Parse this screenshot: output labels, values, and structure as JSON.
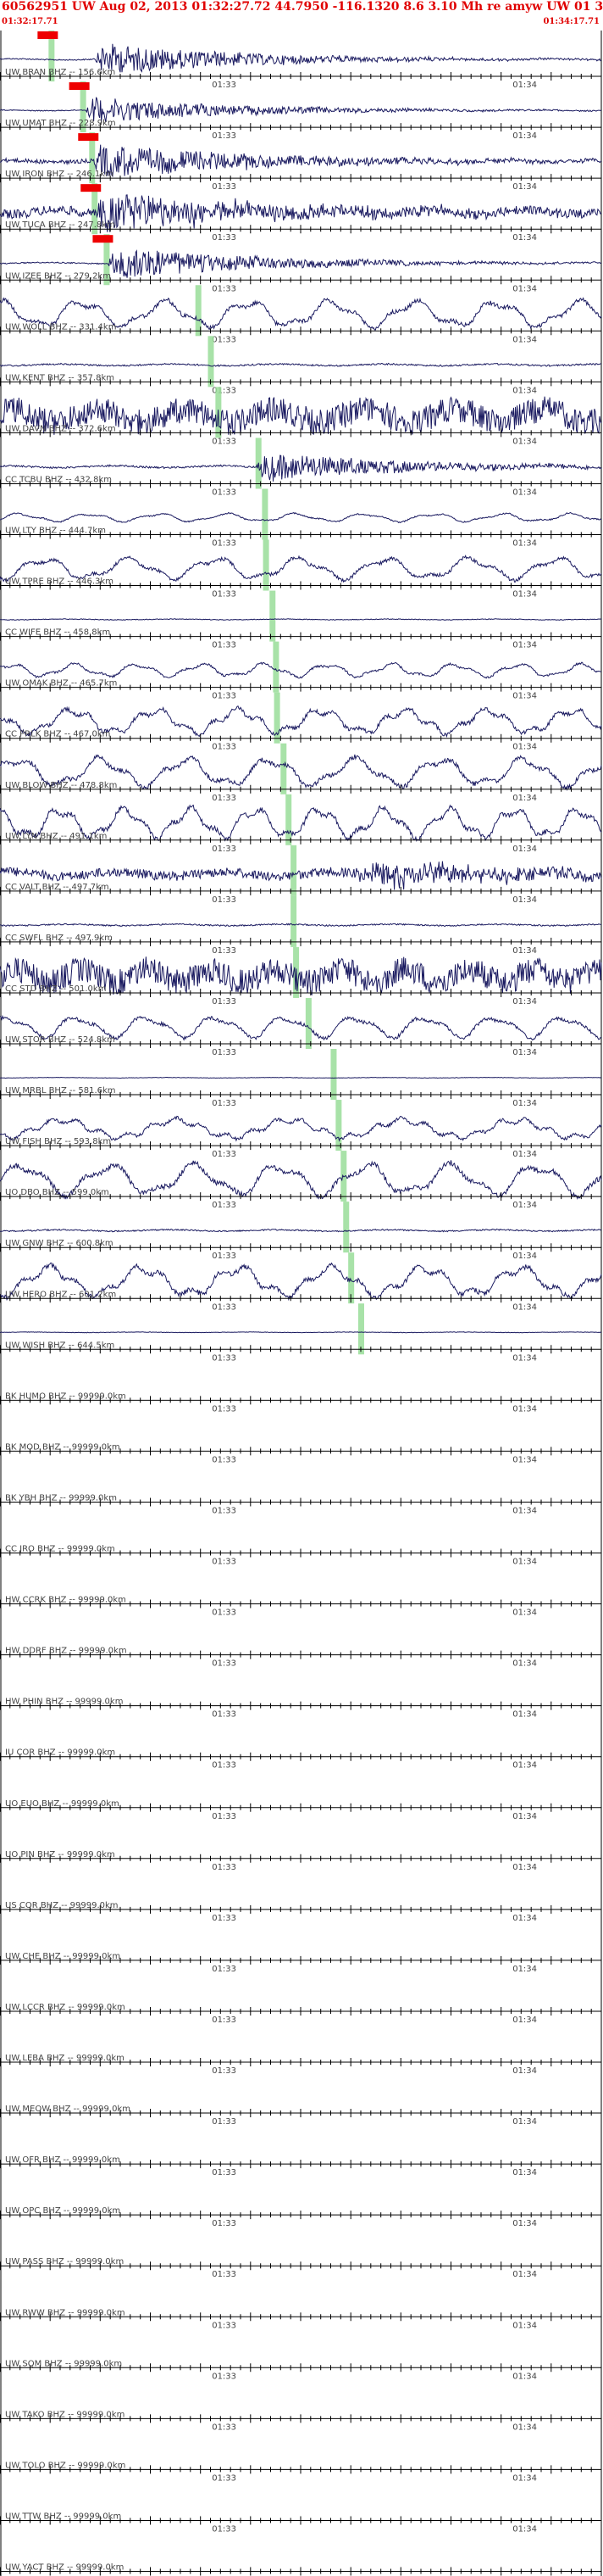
{
  "header": {
    "title": "60562951 UW Aug 02, 2013 01:32:27.72   44.7950  -116.1320  8.6 3.10 Mh re amyw UW 01   3",
    "start_time": "01:32:17.71",
    "end_time": "01:34:17.71"
  },
  "colors": {
    "header_text": "#e00000",
    "trace": "#1a1a60",
    "pick_marker": "#99dd99",
    "pick_flag": "#ee0000",
    "axis": "#000000",
    "label_text": "#444444"
  },
  "chart_data": {
    "type": "line",
    "title": "60562951 UW Aug 02, 2013 01:32:27.72   44.7950  -116.1320  8.6 3.10 Mh re amyw UW 01   3",
    "x_start_time": "01:32:17.71",
    "x_end_time": "01:34:17.71",
    "time_labels": [
      "01:33",
      "01:34"
    ],
    "time_label_seconds": [
      42.29,
      102.29
    ],
    "xlim_seconds": [
      0,
      120
    ],
    "channels": [
      {
        "name": "UW BRAN BHZ -- 156.6km",
        "pick_s": 10.2,
        "has_flag": true,
        "amplitude": 0.25,
        "noise": "low",
        "event_start_s": 19,
        "event_peak": 2.2
      },
      {
        "name": "UW UMAT BHZ -- 228.9km",
        "pick_s": 16.5,
        "has_flag": true,
        "amplitude": 0.2,
        "noise": "low",
        "event_start_s": 17,
        "event_peak": 1.8
      },
      {
        "name": "UW IRON BHZ -- 246.1km",
        "pick_s": 18.3,
        "has_flag": true,
        "amplitude": 0.4,
        "noise": "med",
        "event_start_s": 18.5,
        "event_peak": 2.5
      },
      {
        "name": "UW TUCA BHZ -- 247.8km",
        "pick_s": 18.8,
        "has_flag": true,
        "amplitude": 0.6,
        "noise": "high",
        "event_start_s": 19,
        "event_peak": 2.6
      },
      {
        "name": "UW IZEE BHZ -- 279.2km",
        "pick_s": 21.2,
        "has_flag": true,
        "amplitude": 0.25,
        "noise": "low",
        "event_start_s": 21.5,
        "event_peak": 2.2
      },
      {
        "name": "UW WOLL BHZ -- 331.4km",
        "pick_s": 39.5,
        "has_flag": false,
        "amplitude": 1.6,
        "noise": "wave",
        "event_start_s": 0,
        "event_peak": 0
      },
      {
        "name": "UW KENT BHZ -- 357.8km",
        "pick_s": 42.0,
        "has_flag": false,
        "amplitude": 0.35,
        "noise": "low",
        "event_start_s": 0,
        "event_peak": 0
      },
      {
        "name": "UW DAVN BHZ -- 372.6km",
        "pick_s": 43.5,
        "has_flag": false,
        "amplitude": 1.7,
        "noise": "high",
        "event_start_s": 0,
        "event_peak": 0
      },
      {
        "name": "CC TCBU BHZ -- 432.8km",
        "pick_s": 51.5,
        "has_flag": false,
        "amplitude": 0.4,
        "noise": "low",
        "event_start_s": 51,
        "event_peak": 2.0
      },
      {
        "name": "UW LTY BHZ -- 444.7km",
        "pick_s": 52.8,
        "has_flag": false,
        "amplitude": 0.5,
        "noise": "wave",
        "event_start_s": 0,
        "event_peak": 0
      },
      {
        "name": "UW TPRE BHZ -- 446.3km",
        "pick_s": 53.0,
        "has_flag": false,
        "amplitude": 1.3,
        "noise": "wave",
        "event_start_s": 0,
        "event_peak": 0
      },
      {
        "name": "CC WIFE BHZ -- 458.8km",
        "pick_s": 54.3,
        "has_flag": false,
        "amplitude": 0.15,
        "noise": "low",
        "event_start_s": 0,
        "event_peak": 0
      },
      {
        "name": "UW OMAK BHZ -- 465.7km",
        "pick_s": 55.0,
        "has_flag": false,
        "amplitude": 0.8,
        "noise": "wave",
        "event_start_s": 0,
        "event_peak": 0
      },
      {
        "name": "CC PRLK BHZ -- 467.0km",
        "pick_s": 55.2,
        "has_flag": false,
        "amplitude": 1.5,
        "noise": "wave",
        "event_start_s": 0,
        "event_peak": 0
      },
      {
        "name": "UW BLOW BHZ -- 478.8km",
        "pick_s": 56.5,
        "has_flag": false,
        "amplitude": 1.7,
        "noise": "wave",
        "event_start_s": 0,
        "event_peak": 0
      },
      {
        "name": "UW LYN BHZ -- 491.1km",
        "pick_s": 57.5,
        "has_flag": false,
        "amplitude": 1.8,
        "noise": "wave",
        "event_start_s": 0,
        "event_peak": 0
      },
      {
        "name": "CC VALT BHZ -- 497.7km",
        "pick_s": 58.5,
        "has_flag": false,
        "amplitude": 0.6,
        "noise": "high",
        "event_start_s": 71,
        "event_peak": 1.8
      },
      {
        "name": "CC SWFL BHZ -- 497.9km",
        "pick_s": 58.5,
        "has_flag": false,
        "amplitude": 0.3,
        "noise": "low",
        "event_start_s": 0,
        "event_peak": 0
      },
      {
        "name": "CC STD BHZ -- 501.0km",
        "pick_s": 59.0,
        "has_flag": false,
        "amplitude": 1.7,
        "noise": "high",
        "event_start_s": 0,
        "event_peak": 0
      },
      {
        "name": "UW STOR BHZ -- 524.8km",
        "pick_s": 61.5,
        "has_flag": false,
        "amplitude": 1.3,
        "noise": "wave",
        "event_start_s": 0,
        "event_peak": 0
      },
      {
        "name": "UW MRBL BHZ -- 581.6km",
        "pick_s": 66.5,
        "has_flag": false,
        "amplitude": 0.1,
        "noise": "low",
        "event_start_s": 0,
        "event_peak": 0
      },
      {
        "name": "UW FISH BHZ -- 593.8km",
        "pick_s": 67.5,
        "has_flag": false,
        "amplitude": 1.2,
        "noise": "wave",
        "event_start_s": 0,
        "event_peak": 0
      },
      {
        "name": "UO DBO BHZ -- 599.0km",
        "pick_s": 68.5,
        "has_flag": false,
        "amplitude": 1.9,
        "noise": "wave",
        "event_start_s": 0,
        "event_peak": 0
      },
      {
        "name": "UW GNW BHZ -- 600.8km",
        "pick_s": 69.0,
        "has_flag": false,
        "amplitude": 0.3,
        "noise": "low",
        "event_start_s": 0,
        "event_peak": 0
      },
      {
        "name": "UW HERO BHZ -- 601.2km",
        "pick_s": 70.0,
        "has_flag": false,
        "amplitude": 1.8,
        "noise": "wave",
        "event_start_s": 0,
        "event_peak": 0
      },
      {
        "name": "UW WISH BHZ -- 644.5km",
        "pick_s": 72.0,
        "has_flag": false,
        "amplitude": 0.1,
        "noise": "low",
        "event_start_s": 0,
        "event_peak": 0
      },
      {
        "name": "BK HUMO BHZ -- 99999.0km"
      },
      {
        "name": "BK MOD BHZ -- 99999.0km"
      },
      {
        "name": "BK YBH BHZ -- 99999.0km"
      },
      {
        "name": "CC JRO BHZ -- 99999.0km"
      },
      {
        "name": "HW CCRK BHZ -- 99999.0km"
      },
      {
        "name": "HW DDRF BHZ -- 99999.0km"
      },
      {
        "name": "HW PHIN BHZ -- 99999.0km"
      },
      {
        "name": "IU COR BHZ -- 99999.0km"
      },
      {
        "name": "UO EUO BHZ -- 99999.0km"
      },
      {
        "name": "UO PIN BHZ -- 99999.0km"
      },
      {
        "name": "US COR BHZ -- 99999.0km"
      },
      {
        "name": "UW CHE BHZ -- 99999.0km"
      },
      {
        "name": "UW LCCR BHZ -- 99999.0km"
      },
      {
        "name": "UW LEBA BHZ -- 99999.0km"
      },
      {
        "name": "UW MEOW BHZ -- 99999.0km"
      },
      {
        "name": "UW OFR BHZ -- 99999.0km"
      },
      {
        "name": "UW OPC BHZ -- 99999.0km"
      },
      {
        "name": "UW PASS BHZ -- 99999.0km"
      },
      {
        "name": "UW RWW BHZ -- 99999.0km"
      },
      {
        "name": "UW SQM BHZ -- 99999.0km"
      },
      {
        "name": "UW TAKO BHZ -- 99999.0km"
      },
      {
        "name": "UW TOLO BHZ -- 99999.0km"
      },
      {
        "name": "UW TTW BHZ -- 99999.0km"
      },
      {
        "name": "UW YACT BHZ -- 99999.0km"
      }
    ]
  }
}
